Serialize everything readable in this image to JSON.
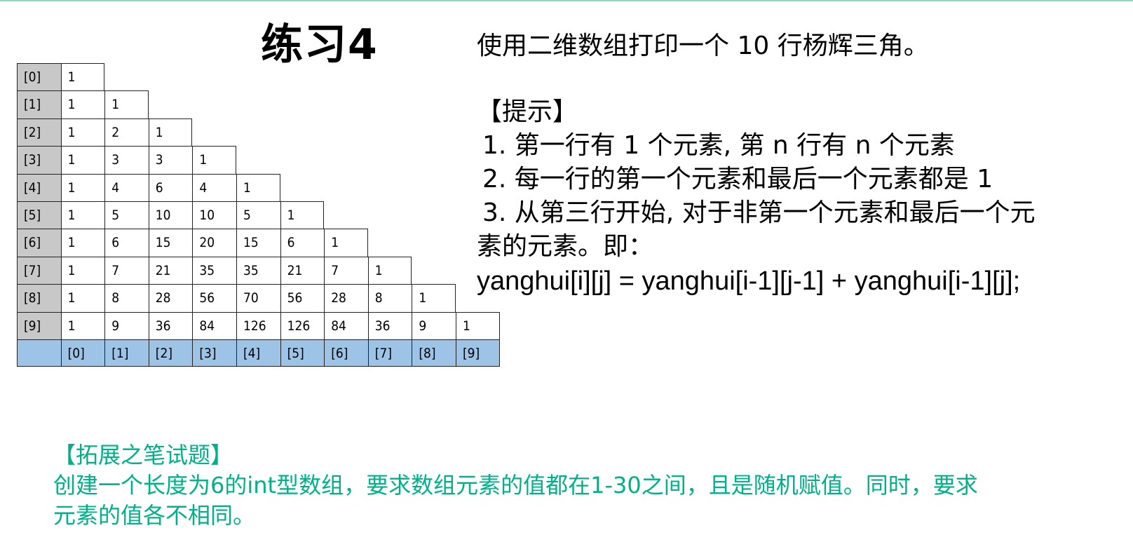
{
  "slide": {
    "title": "练习4",
    "description": "使用二维数组打印一个 10 行杨辉三角。",
    "hint_header": "【提示】",
    "hint_items": [
      "1. 第一行有 1 个元素, 第 n 行有 n 个元素",
      "2. 每一行的第一个元素和最后一个元素都是 1",
      "3. 从第三行开始, 对于非第一个元素和最后一个元"
    ],
    "hint_cont": "素的元素。即：",
    "formula": "yanghui[i][j] = yanghui[i-1][j-1] + yanghui[i-1][j];",
    "extension_header": "【拓展之笔试题】",
    "extension_lines": [
      "创建一个长度为6的int型数组，要求数组元素的值都在1-30之间，且是随机赋值。同时，要求",
      "元素的值各不相同。"
    ]
  },
  "triangle": {
    "row_labels": [
      "[0]",
      "[1]",
      "[2]",
      "[3]",
      "[4]",
      "[5]",
      "[6]",
      "[7]",
      "[8]",
      "[9]"
    ],
    "col_labels": [
      "[0]",
      "[1]",
      "[2]",
      "[3]",
      "[4]",
      "[5]",
      "[6]",
      "[7]",
      "[8]",
      "[9]"
    ],
    "rows": [
      [
        "1"
      ],
      [
        "1",
        "1"
      ],
      [
        "1",
        "2",
        "1"
      ],
      [
        "1",
        "3",
        "3",
        "1"
      ],
      [
        "1",
        "4",
        "6",
        "4",
        "1"
      ],
      [
        "1",
        "5",
        "10",
        "10",
        "5",
        "1"
      ],
      [
        "1",
        "6",
        "15",
        "20",
        "15",
        "6",
        "1"
      ],
      [
        "1",
        "7",
        "21",
        "35",
        "35",
        "21",
        "7",
        "1"
      ],
      [
        "1",
        "8",
        "28",
        "56",
        "70",
        "56",
        "28",
        "8",
        "1"
      ],
      [
        "1",
        "9",
        "36",
        "84",
        "126",
        "126",
        "84",
        "36",
        "9",
        "1"
      ]
    ],
    "colors": {
      "row_header": "#c8c8c8",
      "col_header": "#9dc3e6"
    }
  }
}
